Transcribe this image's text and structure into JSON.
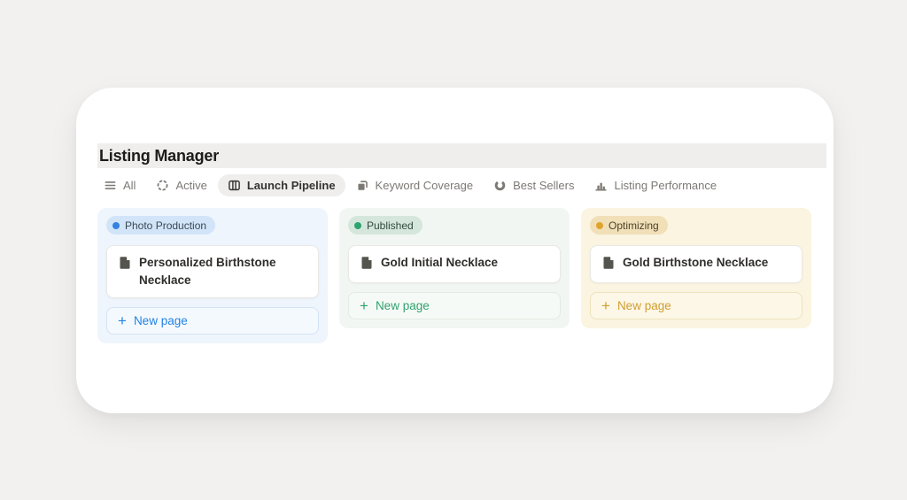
{
  "window": {
    "title": "Listing Manager"
  },
  "tabs": [
    {
      "label": "All",
      "icon": "menu-icon",
      "active": false
    },
    {
      "label": "Active",
      "icon": "spinner-icon",
      "active": false
    },
    {
      "label": "Launch Pipeline",
      "icon": "board-icon",
      "active": true
    },
    {
      "label": "Keyword Coverage",
      "icon": "layers-icon",
      "active": false
    },
    {
      "label": "Best Sellers",
      "icon": "donut-chart-icon",
      "active": false
    },
    {
      "label": "Listing Performance",
      "icon": "bar-chart-icon",
      "active": false
    }
  ],
  "icons": {
    "plus": "+"
  },
  "board": {
    "columns": [
      {
        "status": "Photo Production",
        "column_bg": "#eff5fd",
        "badge_bg": "#d2e4f8",
        "dot_color": "#3582e0",
        "accent_color": "#2383e2",
        "cards": [
          {
            "title": "Personalized Birthstone Necklace"
          }
        ],
        "new_page_label": "New page"
      },
      {
        "status": "Published",
        "column_bg": "#f2f6f2",
        "badge_bg": "#d5e7dc",
        "dot_color": "#2da36e",
        "accent_color": "#31a270",
        "cards": [
          {
            "title": "Gold Initial Necklace"
          }
        ],
        "new_page_label": "New page"
      },
      {
        "status": "Optimizing",
        "column_bg": "#faf4e0",
        "badge_bg": "#f1dfb8",
        "dot_color": "#e0a32e",
        "accent_color": "#d19e2f",
        "cards": [
          {
            "title": "Gold Birthstone Necklace"
          }
        ],
        "new_page_label": "New page"
      }
    ]
  }
}
